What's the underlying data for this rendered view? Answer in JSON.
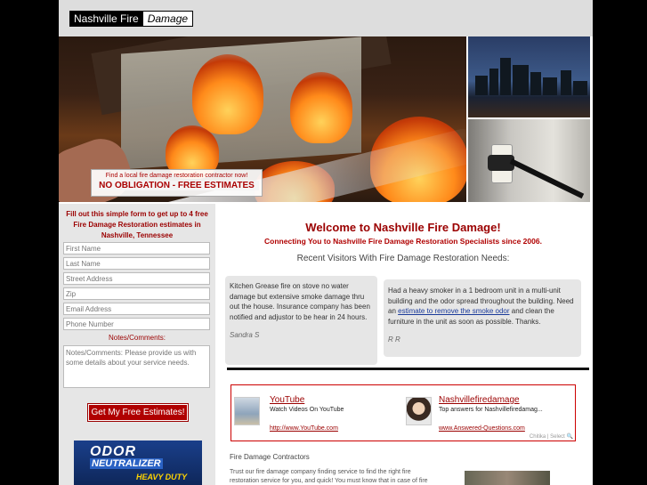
{
  "logo": {
    "part1": "Nashville Fire",
    "part2": "Damage"
  },
  "promo": {
    "line1": "Find a local fire damage restoration contractor now!",
    "line2": "NO OBLIGATION - FREE ESTIMATES"
  },
  "form": {
    "title": "Fill out this simple form to get up to 4 free Fire Damage Restoration estimates in Nashville, Tennessee",
    "fields": [
      "First Name",
      "Last Name",
      "Street Address",
      "Zip",
      "Email Address",
      "Phone Number"
    ],
    "notes_label": "Notes/Comments:",
    "notes_placeholder": "Notes/Comments: Please provide us with some details about your service needs.",
    "submit_label": "Get My Free Estimates!"
  },
  "sidebar_ad": {
    "line1": "ODOR",
    "line2": "NEUTRALIZER",
    "line3": "HEAVY DUTY"
  },
  "main": {
    "welcome": "Welcome to Nashville Fire Damage!",
    "tagline": "Connecting You to Nashville Fire Damage Restoration Specialists since 2006.",
    "recent_heading": "Recent Visitors With Fire Damage Restoration Needs:",
    "visitors": [
      {
        "text": "Kitchen Grease fire on stove no water damage but extensive smoke damage thru out the house. Insurance company has been notified and adjustor to be hear in 24 hours.",
        "name": "Sandra S"
      },
      {
        "text_before": "Had a heavy smoker in a 1 bedroom unit in a multi-unit building and the odor spread throughout the building. Need an ",
        "link": "estimate to remove the smoke odor",
        "text_after": " and clean the furniture in the unit as soon as possible. Thanks.",
        "name": "R R"
      }
    ],
    "contractors_heading": "Fire Damage Contractors",
    "trust_text": "Trust our fire damage company finding service to find the right fire restoration service for you, and quick! You must know that in case of fire"
  },
  "ads": [
    {
      "title": "YouTube",
      "desc": "Watch Videos On YouTube",
      "url": "http://www.YouTube.com"
    },
    {
      "title": "Nashvillefiredamage",
      "desc": "Top answers for Nashvillefiredamag...",
      "url": "www.Answered-Questions.com"
    }
  ],
  "chitika": "Chitika | Select"
}
